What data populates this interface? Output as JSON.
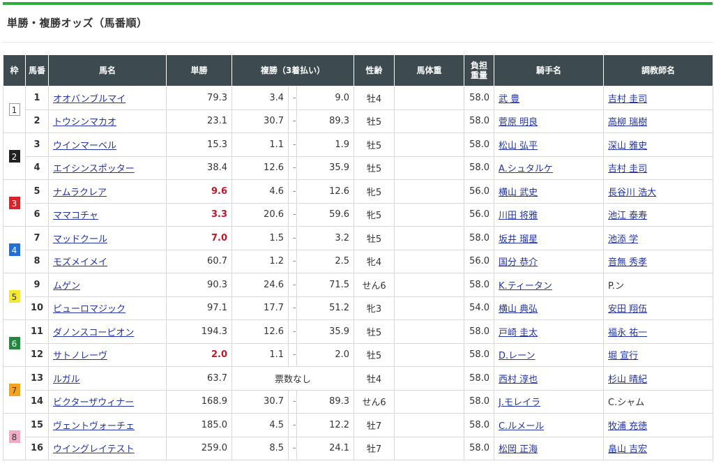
{
  "page": {
    "title": "単勝・複勝オッズ（馬番順）"
  },
  "colors": {
    "accent_bar": "#2bad3b",
    "header_bg": "#3d4a4f",
    "favorite_red": "#c0182a",
    "link_blue": "#2233aa"
  },
  "table": {
    "headers": {
      "waku": "枠",
      "umaban": "馬番",
      "horse": "馬名",
      "win": "単勝",
      "place": "複勝（3着払い）",
      "sex_age": "性齢",
      "body_weight": "馬体重",
      "burden_1": "負担",
      "burden_2": "重量",
      "jockey": "騎手名",
      "trainer": "調教師名"
    },
    "waku_colors": {
      "1": {
        "bg": "#ffffff",
        "fg": "#333333",
        "border": "#999999"
      },
      "2": {
        "bg": "#222222",
        "fg": "#ffffff",
        "border": "#222222"
      },
      "3": {
        "bg": "#d8232a",
        "fg": "#ffffff",
        "border": "#d8232a"
      },
      "4": {
        "bg": "#1e6fd9",
        "fg": "#ffffff",
        "border": "#1e6fd9"
      },
      "5": {
        "bg": "#f5e830",
        "fg": "#333333",
        "border": "#f5e830"
      },
      "6": {
        "bg": "#1f8a3b",
        "fg": "#ffffff",
        "border": "#1f8a3b"
      },
      "7": {
        "bg": "#f7a21b",
        "fg": "#333333",
        "border": "#f7a21b"
      },
      "8": {
        "bg": "#f4a9c4",
        "fg": "#333333",
        "border": "#f4a9c4"
      }
    },
    "rows": [
      {
        "waku": "1",
        "num": "1",
        "horse": "オオバンブルマイ",
        "win": "79.3",
        "fav": false,
        "pmin": "3.4",
        "pmax": "9.0",
        "sex": "牡4",
        "bw": "",
        "burden": "58.0",
        "jockey": "武 豊",
        "jockey_link": true,
        "trainer": "吉村 圭司",
        "trainer_link": true
      },
      {
        "waku": "1",
        "num": "2",
        "horse": "トウシンマカオ",
        "win": "23.1",
        "fav": false,
        "pmin": "30.7",
        "pmax": "89.3",
        "sex": "牡5",
        "bw": "",
        "burden": "58.0",
        "jockey": "菅原 明良",
        "jockey_link": true,
        "trainer": "高柳 瑞樹",
        "trainer_link": true
      },
      {
        "waku": "2",
        "num": "3",
        "horse": "ウインマーベル",
        "win": "15.3",
        "fav": false,
        "pmin": "1.1",
        "pmax": "1.9",
        "sex": "牡5",
        "bw": "",
        "burden": "58.0",
        "jockey": "松山 弘平",
        "jockey_link": true,
        "trainer": "深山 雅史",
        "trainer_link": true
      },
      {
        "waku": "2",
        "num": "4",
        "horse": "エイシンスポッター",
        "win": "38.4",
        "fav": false,
        "pmin": "12.6",
        "pmax": "35.9",
        "sex": "牡5",
        "bw": "",
        "burden": "58.0",
        "jockey": "A.シュタルケ",
        "jockey_link": true,
        "trainer": "吉村 圭司",
        "trainer_link": true
      },
      {
        "waku": "3",
        "num": "5",
        "horse": "ナムラクレア",
        "win": "9.6",
        "fav": true,
        "pmin": "4.6",
        "pmax": "12.6",
        "sex": "牝5",
        "bw": "",
        "burden": "56.0",
        "jockey": "横山 武史",
        "jockey_link": true,
        "trainer": "長谷川 浩大",
        "trainer_link": true
      },
      {
        "waku": "3",
        "num": "6",
        "horse": "ママコチャ",
        "win": "3.3",
        "fav": true,
        "pmin": "20.6",
        "pmax": "59.6",
        "sex": "牝5",
        "bw": "",
        "burden": "56.0",
        "jockey": "川田 将雅",
        "jockey_link": true,
        "trainer": "池江 泰寿",
        "trainer_link": true
      },
      {
        "waku": "4",
        "num": "7",
        "horse": "マッドクール",
        "win": "7.0",
        "fav": true,
        "pmin": "1.5",
        "pmax": "3.2",
        "sex": "牡5",
        "bw": "",
        "burden": "58.0",
        "jockey": "坂井 瑠星",
        "jockey_link": true,
        "trainer": "池添 学",
        "trainer_link": true
      },
      {
        "waku": "4",
        "num": "8",
        "horse": "モズメイメイ",
        "win": "60.7",
        "fav": false,
        "pmin": "1.2",
        "pmax": "2.5",
        "sex": "牝4",
        "bw": "",
        "burden": "56.0",
        "jockey": "国分 恭介",
        "jockey_link": true,
        "trainer": "音無 秀孝",
        "trainer_link": true
      },
      {
        "waku": "5",
        "num": "9",
        "horse": "ムゲン",
        "win": "90.3",
        "fav": false,
        "pmin": "24.6",
        "pmax": "71.5",
        "sex": "せん6",
        "bw": "",
        "burden": "58.0",
        "jockey": "K.ティータン",
        "jockey_link": true,
        "trainer": "P.ン",
        "trainer_link": false
      },
      {
        "waku": "5",
        "num": "10",
        "horse": "ピューロマジック",
        "win": "97.1",
        "fav": false,
        "pmin": "17.7",
        "pmax": "51.2",
        "sex": "牝3",
        "bw": "",
        "burden": "54.0",
        "jockey": "横山 典弘",
        "jockey_link": true,
        "trainer": "安田 翔伍",
        "trainer_link": true
      },
      {
        "waku": "6",
        "num": "11",
        "horse": "ダノンスコーピオン",
        "win": "194.3",
        "fav": false,
        "pmin": "12.6",
        "pmax": "35.9",
        "sex": "牡5",
        "bw": "",
        "burden": "58.0",
        "jockey": "戸崎 圭太",
        "jockey_link": true,
        "trainer": "福永 祐一",
        "trainer_link": true
      },
      {
        "waku": "6",
        "num": "12",
        "horse": "サトノレーヴ",
        "win": "2.0",
        "fav": true,
        "pmin": "1.1",
        "pmax": "2.0",
        "sex": "牡5",
        "bw": "",
        "burden": "58.0",
        "jockey": "D.レーン",
        "jockey_link": true,
        "trainer": "堀 宣行",
        "trainer_link": true
      },
      {
        "waku": "7",
        "num": "13",
        "horse": "ルガル",
        "win": "63.7",
        "fav": false,
        "no_place": "票数なし",
        "sex": "牡4",
        "bw": "",
        "burden": "58.0",
        "jockey": "西村 淳也",
        "jockey_link": true,
        "trainer": "杉山 晴紀",
        "trainer_link": true
      },
      {
        "waku": "7",
        "num": "14",
        "horse": "ビクターザウィナー",
        "win": "168.9",
        "fav": false,
        "pmin": "30.7",
        "pmax": "89.3",
        "sex": "せん6",
        "bw": "",
        "burden": "58.0",
        "jockey": "J.モレイラ",
        "jockey_link": true,
        "trainer": "C.シャム",
        "trainer_link": false
      },
      {
        "waku": "8",
        "num": "15",
        "horse": "ヴェントヴォーチェ",
        "win": "185.0",
        "fav": false,
        "pmin": "4.5",
        "pmax": "12.2",
        "sex": "牡7",
        "bw": "",
        "burden": "58.0",
        "jockey": "C.ルメール",
        "jockey_link": true,
        "trainer": "牧浦 充徳",
        "trainer_link": true
      },
      {
        "waku": "8",
        "num": "16",
        "horse": "ウイングレイテスト",
        "win": "259.0",
        "fav": false,
        "pmin": "8.5",
        "pmax": "24.1",
        "sex": "牡7",
        "bw": "",
        "burden": "58.0",
        "jockey": "松岡 正海",
        "jockey_link": true,
        "trainer": "畠山 吉宏",
        "trainer_link": true
      }
    ]
  }
}
